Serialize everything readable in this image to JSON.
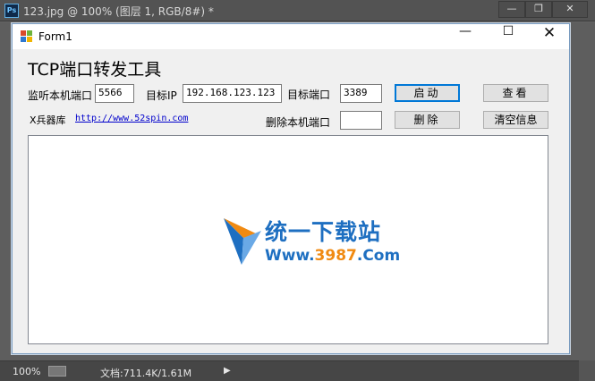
{
  "ps": {
    "logo": "Ps",
    "title": "123.jpg @ 100% (图层 1, RGB/8#) *",
    "controls": {
      "minimize": "—",
      "maximize": "❐",
      "close": "✕"
    },
    "status": {
      "zoom": "100%",
      "doc_size": "文档:711.4K/1.61M",
      "arrow": "▶"
    }
  },
  "form": {
    "title": "Form1",
    "controls": {
      "minimize": "—",
      "maximize": "☐",
      "close": "✕"
    },
    "heading": "TCP端口转发工具",
    "listen_port_label": "监听本机端口",
    "listen_port_value": "5566",
    "target_ip_label": "目标IP",
    "target_ip_value": "192.168.123.123",
    "target_port_label": "目标端口",
    "target_port_value": "3389",
    "start_button": "启动",
    "view_button": "查看",
    "credit_label": "X兵器库",
    "credit_link": "http://www.52spin.com",
    "delete_port_label": "删除本机端口",
    "delete_port_value": "",
    "delete_button": "删除",
    "clear_button": "清空信息",
    "log_text": ""
  },
  "watermark": {
    "name": "统一下载站",
    "url_prefix": "Www.",
    "url_number": "3987",
    "url_suffix": ".Com"
  },
  "colors": {
    "accent": "#0078d7",
    "watermark_blue": "#1e6fc1",
    "watermark_orange": "#f08a12"
  }
}
